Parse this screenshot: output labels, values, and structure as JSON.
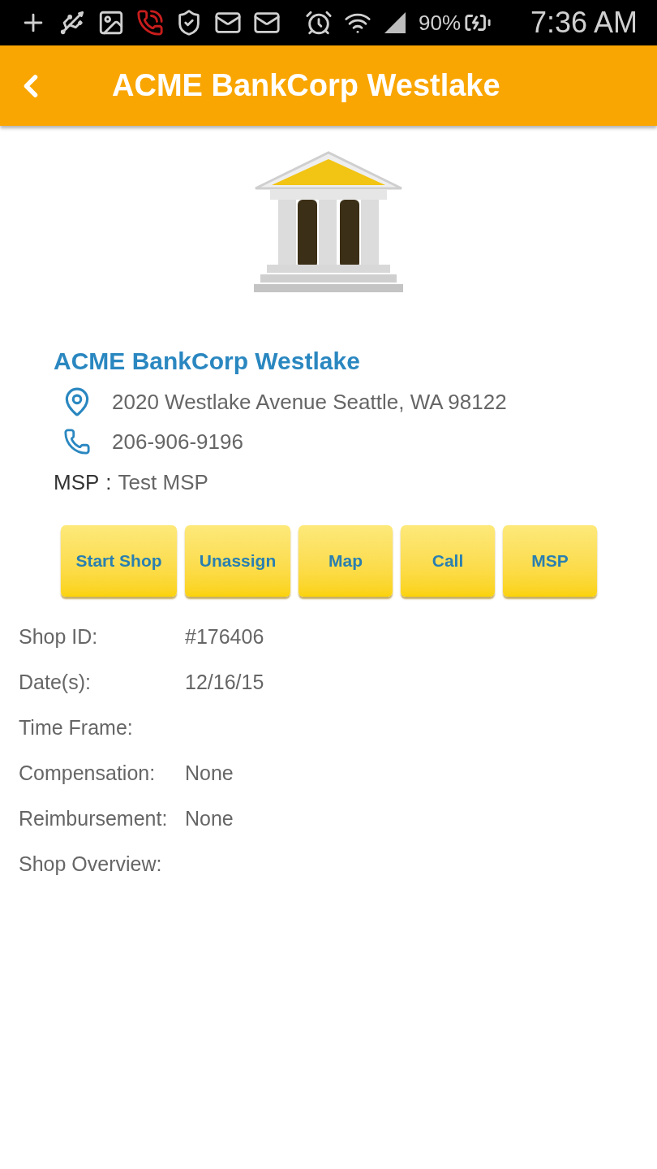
{
  "status_bar": {
    "battery_percent": "90%",
    "time": "7:36 AM"
  },
  "app_bar": {
    "title": "ACME BankCorp Westlake"
  },
  "location": {
    "name": "ACME BankCorp Westlake",
    "address": "2020 Westlake Avenue Seattle, WA 98122",
    "phone": "206-906-9196",
    "msp_label": "MSP",
    "msp_separator": ":",
    "msp_value": "Test MSP"
  },
  "buttons": [
    "Start Shop",
    "Unassign",
    "Map",
    "Call",
    "MSP"
  ],
  "details": [
    {
      "label": "Shop ID:",
      "value": "#176406"
    },
    {
      "label": "Date(s):",
      "value": "12/16/15"
    },
    {
      "label": "Time Frame:"
    },
    {
      "label": "Compensation:",
      "value": "None"
    },
    {
      "label": "Reimbursement:",
      "value": "None"
    },
    {
      "label": "Shop Overview:"
    }
  ]
}
